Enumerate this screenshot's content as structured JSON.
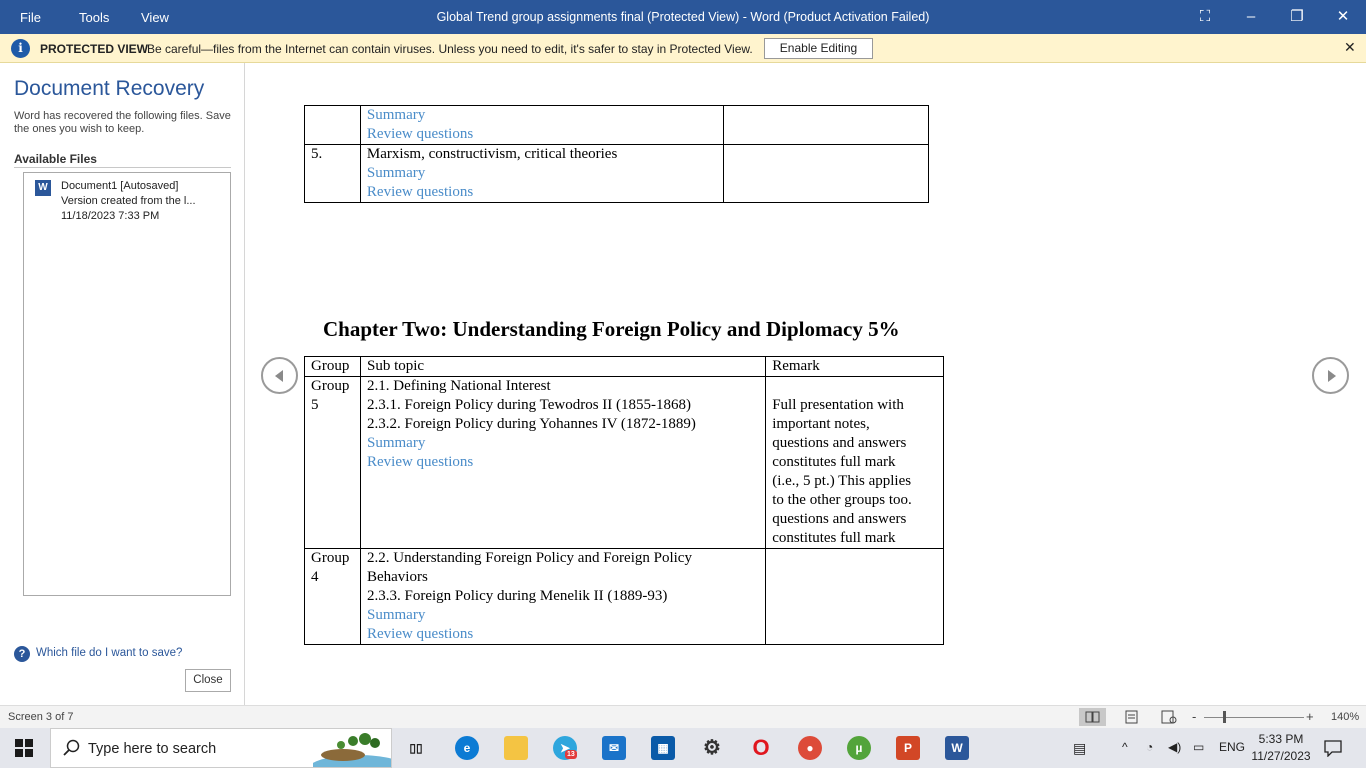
{
  "titlebar": {
    "menu": [
      "File",
      "Tools",
      "View"
    ],
    "title": "Global Trend group assignments final (Protected View) - Word (Product Activation Failed)",
    "controls": {
      "fullscreen": "⛶",
      "minimize": "–",
      "restore": "❐",
      "close": "✕"
    }
  },
  "protected_bar": {
    "label": "PROTECTED VIEW",
    "message": "Be careful—files from the Internet can contain viruses. Unless you need to edit, it's safer to stay in Protected View.",
    "button": "Enable Editing",
    "close": "✕"
  },
  "recovery": {
    "title": "Document Recovery",
    "description": "Word has recovered the following files. Save the ones you wish to keep.",
    "available_label": "Available Files",
    "file": {
      "icon": "W",
      "name": "Document1  [Autosaved]",
      "version": "Version created from the l...",
      "date": "11/18/2023 7:33 PM"
    },
    "help_icon": "?",
    "help_link": "Which file do I want to save?",
    "close_button": "Close"
  },
  "document": {
    "top_table": [
      {
        "num": "",
        "lines": [
          {
            "text": "Summary",
            "style": "blue"
          },
          {
            "text": "Review questions",
            "style": "blue"
          }
        ],
        "remark": ""
      },
      {
        "num": "5.",
        "lines": [
          {
            "text": "Marxism, constructivism, critical theories",
            "style": "plain"
          },
          {
            "text": "Summary",
            "style": "blue"
          },
          {
            "text": "Review questions",
            "style": "blue"
          }
        ],
        "remark": ""
      }
    ],
    "chapter_heading": "Chapter Two: Understanding Foreign Policy and Diplomacy 5%",
    "table": {
      "headers": [
        "Group",
        "Sub topic",
        "Remark"
      ],
      "rows": [
        {
          "group": [
            "Group",
            "5"
          ],
          "lines": [
            {
              "text": "2.1. Defining National Interest",
              "style": "plain"
            },
            {
              "text": "2.3.1. Foreign Policy during Tewodros II (1855-1868)",
              "style": "plain"
            },
            {
              "text": "2.3.2. Foreign Policy during Yohannes IV (1872-1889)",
              "style": "plain"
            },
            {
              "text": "Summary",
              "style": "blue"
            },
            {
              "text": "Review questions",
              "style": "blue"
            }
          ],
          "remark": [
            "",
            "Full presentation with",
            "important notes,",
            "questions and answers",
            "constitutes full mark",
            "(i.e., 5 pt.) This applies",
            "to the other groups too.",
            "questions and answers",
            "constitutes full mark"
          ]
        },
        {
          "group": [
            "Group",
            "4"
          ],
          "lines": [
            {
              "text": "2.2. Understanding Foreign Policy and Foreign Policy",
              "style": "plain"
            },
            {
              "text": "Behaviors",
              "style": "plain"
            },
            {
              "text": "2.3.3. Foreign Policy during Menelik II (1889-93)",
              "style": "plain"
            },
            {
              "text": "Summary",
              "style": "blue"
            },
            {
              "text": "Review questions",
              "style": "blue"
            }
          ],
          "remark": []
        }
      ]
    }
  },
  "statusbar": {
    "screen": "Screen 3 of 7",
    "zoom_minus": "-",
    "zoom_plus": "+",
    "zoom": "140%"
  },
  "taskbar": {
    "search_placeholder": "Type here to search",
    "telegram_badge": "13",
    "tray_lang": "ENG",
    "time": "5:33 PM",
    "date": "11/27/2023"
  },
  "colors": {
    "word_blue": "#2b579a",
    "protected_yellow": "#fff4ce",
    "link_blue": "#4a8cc9"
  }
}
